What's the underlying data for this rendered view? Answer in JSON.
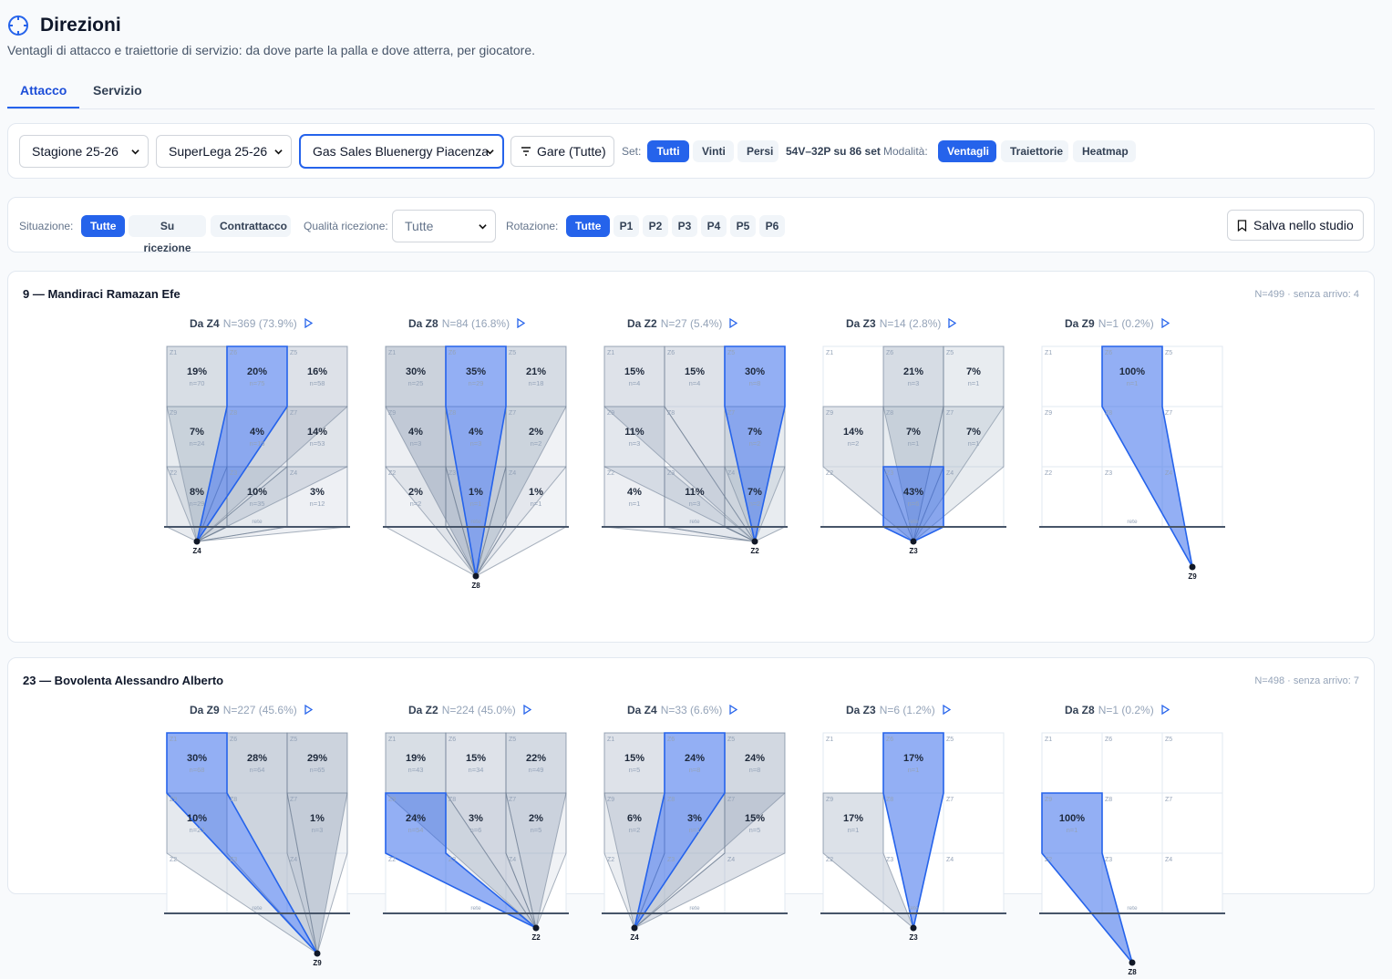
{
  "header": {
    "title": "Direzioni",
    "subtitle": "Ventagli di attacco e traiettorie di servizio: da dove parte la palla e dove atterra, per giocatore.",
    "icon": "crosshair-icon"
  },
  "tabs": [
    {
      "label": "Attacco",
      "active": true
    },
    {
      "label": "Servizio",
      "active": false
    }
  ],
  "filters": {
    "season": "Stagione 25-26",
    "league": "SuperLega 25-26",
    "team": "Gas Sales Bluenergy Piacenza",
    "games_button": "Gare (Tutte)",
    "set_label": "Set:",
    "set_options": [
      "Tutti",
      "Vinti",
      "Persi"
    ],
    "set_selected": "Tutti",
    "set_summary": "54V–32P su 86 set",
    "mode_label": "Modalità:",
    "mode_options": [
      "Ventagli",
      "Traiettorie",
      "Heatmap"
    ],
    "mode_selected": "Ventagli"
  },
  "filters2": {
    "situation_label": "Situazione:",
    "situation_options": [
      "Tutte",
      "Su ricezione",
      "Contrattacco"
    ],
    "situation_selected": "Tutte",
    "quality_label": "Qualità ricezione:",
    "quality_value": "Tutte",
    "rotation_label": "Rotazione:",
    "rotation_options": [
      "Tutte",
      "P1",
      "P2",
      "P3",
      "P4",
      "P5",
      "P6"
    ],
    "rotation_selected": "Tutte",
    "save_button": "Salva nello studio"
  },
  "labels": {
    "zones": [
      [
        "Z1",
        "Z6",
        "Z5"
      ],
      [
        "Z9",
        "Z8",
        "Z7"
      ],
      [
        "Z2",
        "Z3",
        "Z4"
      ]
    ],
    "net": "rete"
  },
  "colors": {
    "accent": "#2563eb",
    "fan_gray": "#94a3b8",
    "net": "#475569"
  },
  "players": [
    {
      "title": "9 — Mandiraci Ramazan Efe",
      "meta": "N=499 · senza arrivo: 4",
      "panels": [
        {
          "label": "Da Z4",
          "n": "N=369 (73.9%)",
          "origin": "Z4",
          "cells": [
            [
              [
                "19%",
                "n=70"
              ],
              [
                "20%",
                "n=75"
              ],
              [
                "16%",
                "n=58"
              ]
            ],
            [
              [
                "7%",
                "n=24"
              ],
              [
                "4%",
                "n=15"
              ],
              [
                "14%",
                "n=53"
              ]
            ],
            [
              [
                "8%",
                "n=29"
              ],
              [
                "10%",
                "n=35"
              ],
              [
                "3%",
                "n=12"
              ]
            ]
          ]
        },
        {
          "label": "Da Z8",
          "n": "N=84 (16.8%)",
          "origin": "Z8",
          "cells": [
            [
              [
                "30%",
                "n=25"
              ],
              [
                "35%",
                "n=29"
              ],
              [
                "21%",
                "n=18"
              ]
            ],
            [
              [
                "4%",
                "n=3"
              ],
              [
                "4%",
                "n=3"
              ],
              [
                "2%",
                "n=2"
              ]
            ],
            [
              [
                "2%",
                "n=2"
              ],
              [
                "1%",
                "n=1"
              ],
              [
                "1%",
                "n=1"
              ]
            ]
          ]
        },
        {
          "label": "Da Z2",
          "n": "N=27 (5.4%)",
          "origin": "Z2",
          "cells": [
            [
              [
                "15%",
                "n=4"
              ],
              [
                "15%",
                "n=4"
              ],
              [
                "30%",
                "n=8"
              ]
            ],
            [
              [
                "11%",
                "n=3"
              ],
              [
                "",
                ""
              ],
              [
                "7%",
                "n=2"
              ]
            ],
            [
              [
                "4%",
                "n=1"
              ],
              [
                "11%",
                "n=3"
              ],
              [
                "7%",
                "n=2"
              ]
            ]
          ]
        },
        {
          "label": "Da Z3",
          "n": "N=14 (2.8%)",
          "origin": "Z3",
          "cells": [
            [
              [
                "",
                ""
              ],
              [
                "21%",
                "n=3"
              ],
              [
                "7%",
                "n=1"
              ]
            ],
            [
              [
                "14%",
                "n=2"
              ],
              [
                "7%",
                "n=1"
              ],
              [
                "7%",
                "n=1"
              ]
            ],
            [
              [
                "",
                ""
              ],
              [
                "43%",
                "n=6"
              ],
              [
                "",
                ""
              ]
            ]
          ]
        },
        {
          "label": "Da Z9",
          "n": "N=1 (0.2%)",
          "origin": "Z9",
          "cells": [
            [
              [
                "",
                ""
              ],
              [
                "100%",
                "n=1"
              ],
              [
                "",
                ""
              ]
            ],
            [
              [
                "",
                ""
              ],
              [
                "",
                ""
              ],
              [
                "",
                ""
              ]
            ],
            [
              [
                "",
                ""
              ],
              [
                "",
                ""
              ],
              [
                "",
                ""
              ]
            ]
          ]
        }
      ]
    },
    {
      "title": "23 — Bovolenta Alessandro Alberto",
      "meta": "N=498 · senza arrivo: 7",
      "panels": [
        {
          "label": "Da Z9",
          "n": "N=227 (45.6%)",
          "origin": "Z9",
          "cells": [
            [
              [
                "30%",
                "n=68"
              ],
              [
                "28%",
                "n=64"
              ],
              [
                "29%",
                "n=65"
              ]
            ],
            [
              [
                "10%",
                "n=23"
              ],
              [
                "",
                ""
              ],
              [
                "1%",
                "n=3"
              ]
            ],
            [
              [
                "",
                ""
              ],
              [
                "",
                ""
              ],
              [
                "",
                ""
              ]
            ]
          ]
        },
        {
          "label": "Da Z2",
          "n": "N=224 (45.0%)",
          "origin": "Z2",
          "cells": [
            [
              [
                "19%",
                "n=43"
              ],
              [
                "15%",
                "n=34"
              ],
              [
                "22%",
                "n=49"
              ]
            ],
            [
              [
                "24%",
                "n=54"
              ],
              [
                "3%",
                "n=6"
              ],
              [
                "2%",
                "n=5"
              ]
            ],
            [
              [
                "",
                ""
              ],
              [
                "",
                ""
              ],
              [
                "",
                ""
              ]
            ]
          ]
        },
        {
          "label": "Da Z4",
          "n": "N=33 (6.6%)",
          "origin": "Z4",
          "cells": [
            [
              [
                "15%",
                "n=5"
              ],
              [
                "24%",
                "n=8"
              ],
              [
                "24%",
                "n=8"
              ]
            ],
            [
              [
                "6%",
                "n=2"
              ],
              [
                "3%",
                "n=1"
              ],
              [
                "15%",
                "n=5"
              ]
            ],
            [
              [
                "",
                ""
              ],
              [
                "",
                ""
              ],
              [
                "",
                ""
              ]
            ]
          ]
        },
        {
          "label": "Da Z3",
          "n": "N=6 (1.2%)",
          "origin": "Z3",
          "cells": [
            [
              [
                "",
                ""
              ],
              [
                "17%",
                "n=1"
              ],
              [
                "",
                ""
              ]
            ],
            [
              [
                "17%",
                "n=1"
              ],
              [
                "",
                ""
              ],
              [
                "",
                ""
              ]
            ],
            [
              [
                "",
                ""
              ],
              [
                "",
                ""
              ],
              [
                "",
                ""
              ]
            ]
          ]
        },
        {
          "label": "Da Z8",
          "n": "N=1 (0.2%)",
          "origin": "Z8",
          "cells": [
            [
              [
                "",
                ""
              ],
              [
                "",
                ""
              ],
              [
                "",
                ""
              ]
            ],
            [
              [
                "100%",
                "n=1"
              ],
              [
                "",
                ""
              ],
              [
                "",
                ""
              ]
            ],
            [
              [
                "",
                ""
              ],
              [
                "",
                ""
              ],
              [
                "",
                ""
              ]
            ]
          ]
        }
      ]
    }
  ]
}
